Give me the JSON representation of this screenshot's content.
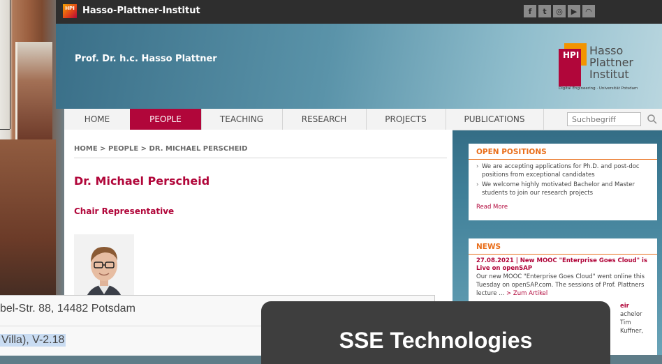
{
  "topbar": {
    "logo_badge": "HPI",
    "site_name": "Hasso-Plattner-Institut",
    "social_icons": [
      "facebook-icon",
      "twitter-icon",
      "instagram-icon",
      "youtube-icon",
      "rss-icon"
    ],
    "social_glyphs": [
      "f",
      "t",
      "◎",
      "▶",
      "◠"
    ]
  },
  "header": {
    "professor": "Prof. Dr. h.c. Hasso Plattner",
    "logo": {
      "mark": "HPI",
      "word1": "Hasso",
      "word2": "Plattner",
      "word3": "Institut",
      "subtitle": "Digital Engineering · Universität Potsdam"
    }
  },
  "nav": {
    "items": [
      {
        "label": "HOME",
        "active": false
      },
      {
        "label": "PEOPLE",
        "active": true
      },
      {
        "label": "TEACHING",
        "active": false
      },
      {
        "label": "RESEARCH",
        "active": false
      },
      {
        "label": "PROJECTS",
        "active": false
      },
      {
        "label": "PUBLICATIONS",
        "active": false
      }
    ],
    "search_placeholder": "Suchbegriff"
  },
  "main": {
    "breadcrumb": "HOME > PEOPLE > DR. MICHAEL PERSCHEID",
    "name": "Dr. Michael Perscheid",
    "role": "Chair Representative"
  },
  "sidebar": {
    "open_positions": {
      "title": "OPEN POSITIONS",
      "items": [
        "We are accepting applications for Ph.D. and post-doc positions from exceptional candidates",
        "We welcome highly motivated Bachelor and Master students to join our research projects"
      ],
      "read_more": "Read More"
    },
    "news": {
      "title": "NEWS",
      "headline": "27.08.2021 | New MOOC \"Enterprise Goes Cloud\" is Live on openSAP",
      "body": "Our new MOOC \"Enterprise Goes Cloud\" went online this Tuesday on openSAP.com. The sessions of Prof. Plattners lecture ...",
      "link": "> Zum Artikel",
      "partial_1": "eir",
      "partial_2": "achelor",
      "partial_3": "Tim Kuffner,"
    }
  },
  "overlay": {
    "address_line1": "bel-Str. 88, 14482 Potsdam",
    "address_line2": "Villa), V-2.18",
    "sse_title": "SSE Technologies"
  },
  "colors": {
    "brand": "#b1063a",
    "accent_orange": "#e96e1a",
    "topbar": "#2e2e2e"
  }
}
